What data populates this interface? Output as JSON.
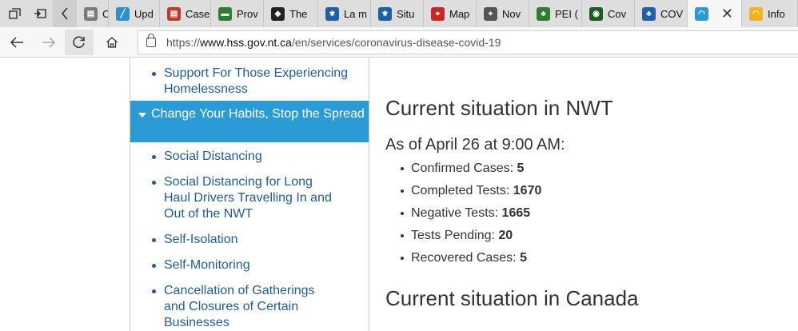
{
  "browser": {
    "tabs": [
      {
        "title": "Case",
        "icon": "page-icon",
        "color": "#7a7a7a"
      },
      {
        "title": "Upd",
        "icon": "chart-icon",
        "color": "#2b8fd6"
      },
      {
        "title": "Case",
        "icon": "page-icon",
        "color": "#c0392b"
      },
      {
        "title": "Prov",
        "icon": "flag-icon",
        "color": "#2e7d32"
      },
      {
        "title": "The",
        "icon": "shield-icon",
        "color": "#222222"
      },
      {
        "title": "La m",
        "icon": "fleur-de-lis-icon",
        "color": "#1f5fa8"
      },
      {
        "title": "Situ",
        "icon": "fleur-de-lis-icon",
        "color": "#1f5fa8"
      },
      {
        "title": "Map",
        "icon": "map-icon",
        "color": "#c62828"
      },
      {
        "title": "Nov",
        "icon": "map-icon",
        "color": "#555555"
      },
      {
        "title": "PEI (",
        "icon": "crest-icon",
        "color": "#2e7d32"
      },
      {
        "title": "Cov",
        "icon": "globe-icon",
        "color": "#1b5e20"
      },
      {
        "title": "COV",
        "icon": "crest-icon",
        "color": "#1f5fa8"
      },
      {
        "title": "",
        "icon": "nwt-logo-icon",
        "color": "#2b9bd6"
      },
      {
        "title": "Info",
        "icon": "sun-icon",
        "color": "#f2b21b"
      }
    ],
    "url_prefix": "https://",
    "url_host": "www.hss.gov.nt.ca",
    "url_path": "/en/services/coronavirus-disease-covid-19"
  },
  "sidebar": {
    "item_homelessness": "Support For Those Experiencing Homelessness",
    "active_item": "Change Your Habits, Stop the Spread",
    "subitems": [
      "Social Distancing",
      "Social Distancing for Long Haul Drivers Travelling In and Out of the NWT",
      "Self-Isolation",
      "Self-Monitoring",
      "Cancellation of Gatherings and Closures of Certain Businesses"
    ]
  },
  "main": {
    "heading_nwt": "Current situation in NWT",
    "as_of": "As of April 26 at 9:00 AM:",
    "stats": [
      {
        "label": "Confirmed Cases:",
        "value": "5"
      },
      {
        "label": "Completed Tests:",
        "value": "1670"
      },
      {
        "label": "Negative Tests:",
        "value": "1665"
      },
      {
        "label": "Tests Pending:",
        "value": "20"
      },
      {
        "label": "Recovered Cases:",
        "value": "5"
      }
    ],
    "heading_canada": "Current situation in Canada"
  }
}
